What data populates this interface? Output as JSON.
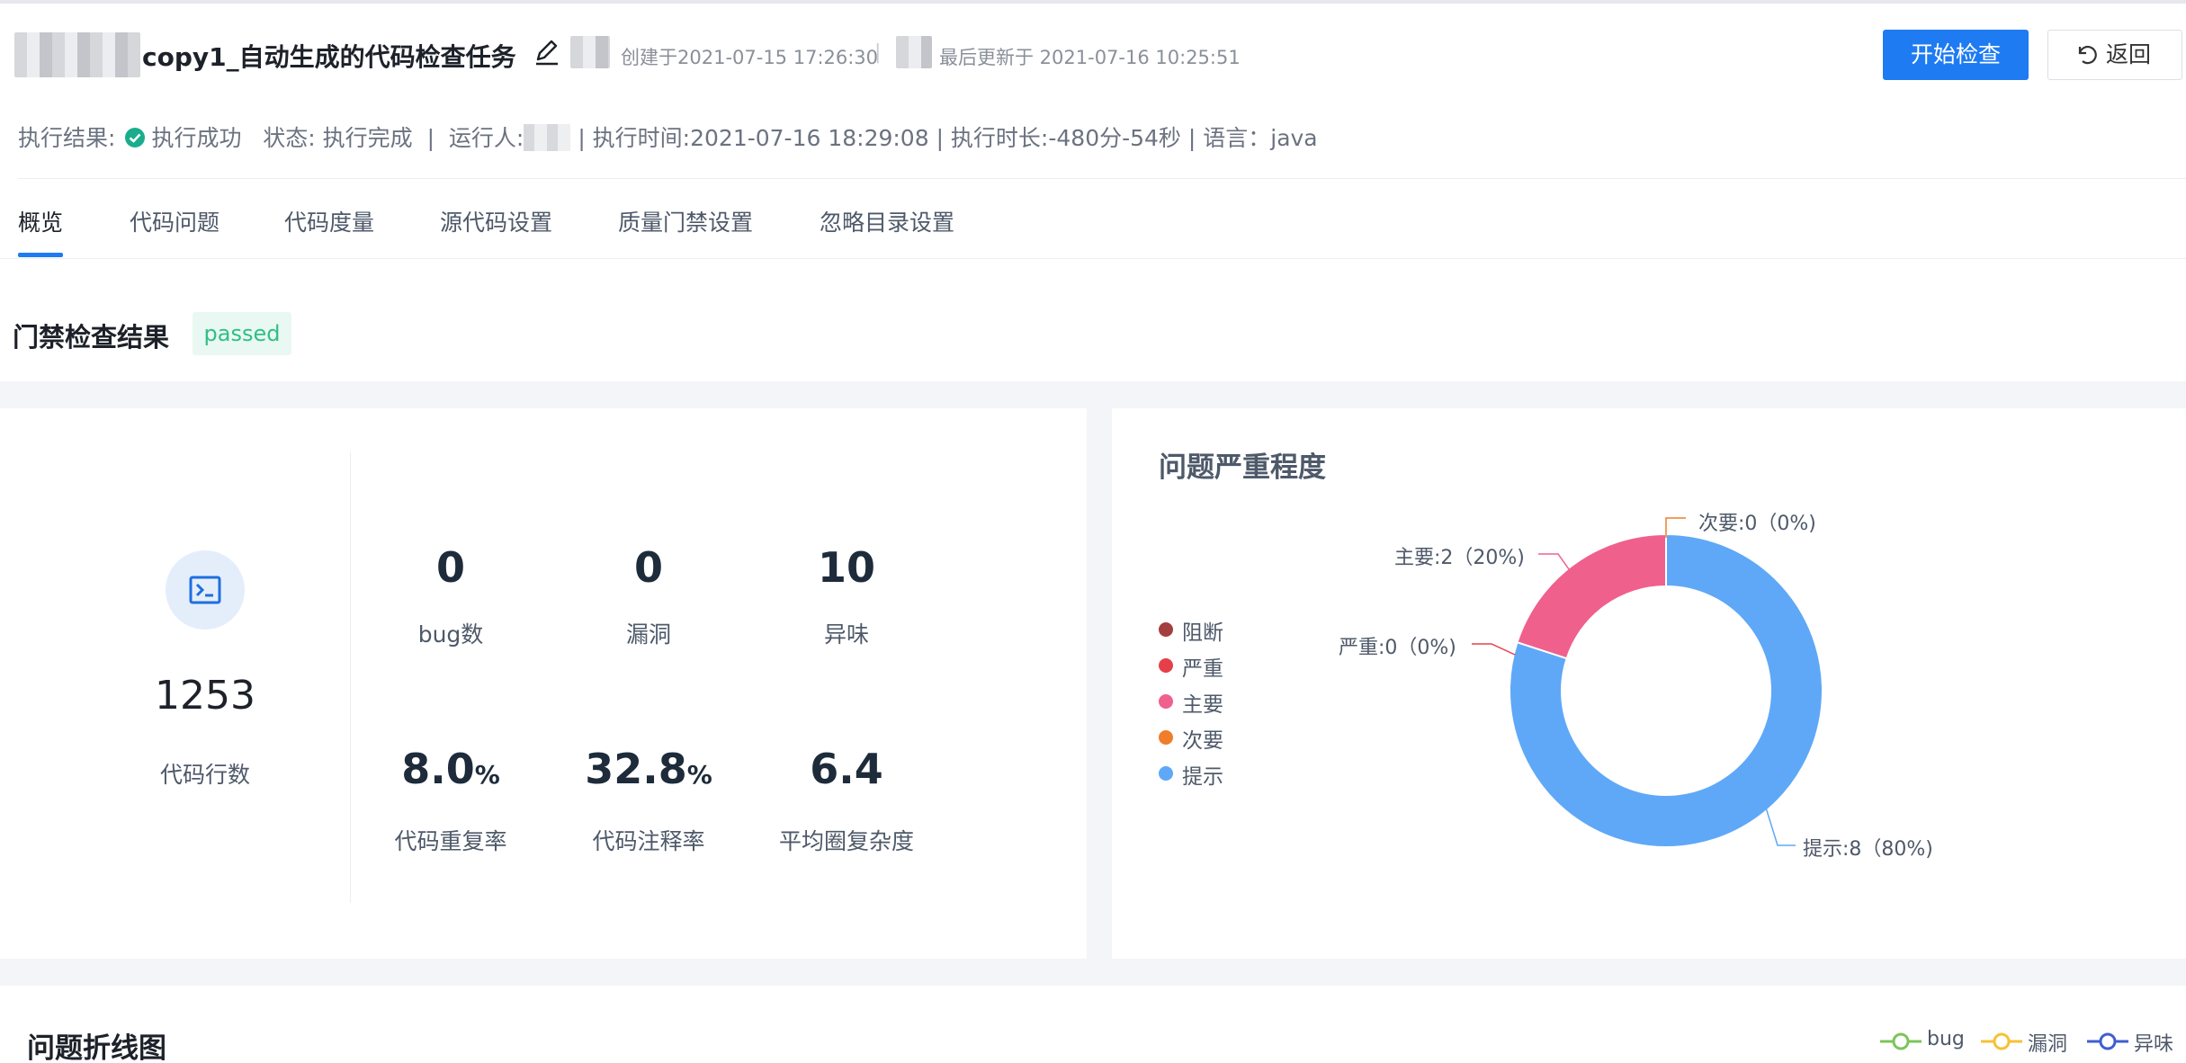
{
  "header": {
    "task_name": "copy1_自动生成的代码检查任务",
    "created": "创建于2021-07-15 17:26:30",
    "updated": "最后更新于 2021-07-16 10:25:51",
    "separator": "|",
    "start_button": "开始检查",
    "back_button": "返回"
  },
  "exec_info": {
    "result_label": "执行结果:",
    "result_value": "执行成功",
    "status": "状态: 执行完成",
    "runner_label": "运行人:",
    "rest": "| 执行时间:2021-07-16 18:29:08 | 执行时长:-480分-54秒 | 语言：java",
    "pipe": "|"
  },
  "tabs": [
    "概览",
    "代码问题",
    "代码度量",
    "源代码设置",
    "质量门禁设置",
    "忽略目录设置"
  ],
  "gate": {
    "title": "门禁检查结果",
    "status": "passed"
  },
  "stats": {
    "lines_value": "1253",
    "lines_label": "代码行数",
    "metrics": [
      {
        "value": "0",
        "unit": "",
        "label": "bug数"
      },
      {
        "value": "0",
        "unit": "",
        "label": "漏洞"
      },
      {
        "value": "10",
        "unit": "",
        "label": "异味"
      },
      {
        "value": "8.0",
        "unit": "%",
        "label": "代码重复率"
      },
      {
        "value": "32.8",
        "unit": "%",
        "label": "代码注释率"
      },
      {
        "value": "6.4",
        "unit": "",
        "label": "平均圈复杂度"
      }
    ]
  },
  "severity": {
    "title": "问题严重程度",
    "legend": [
      {
        "label": "阻断",
        "color": "#a33f3f"
      },
      {
        "label": "严重",
        "color": "#e5404a"
      },
      {
        "label": "主要",
        "color": "#f0608c"
      },
      {
        "label": "次要",
        "color": "#f07d2a"
      },
      {
        "label": "提示",
        "color": "#5fa8f7"
      }
    ],
    "callouts": {
      "minor": "次要:0（0%)",
      "major": "主要:2（20%)",
      "critical": "严重:0（0%)",
      "info": "提示:8（80%)"
    }
  },
  "chart_data": {
    "type": "pie",
    "donut": true,
    "categories": [
      "阻断",
      "严重",
      "主要",
      "次要",
      "提示"
    ],
    "values": [
      0,
      0,
      2,
      0,
      8
    ],
    "colors": [
      "#a33f3f",
      "#e5404a",
      "#f0608c",
      "#f07d2a",
      "#5fa8f7"
    ],
    "title": "问题严重程度"
  },
  "line_chart": {
    "title": "问题折线图",
    "legend": [
      {
        "label": "bug",
        "color": "#7cc45a"
      },
      {
        "label": "漏洞",
        "color": "#f5c237"
      },
      {
        "label": "异味",
        "color": "#3f5ecf"
      }
    ]
  }
}
